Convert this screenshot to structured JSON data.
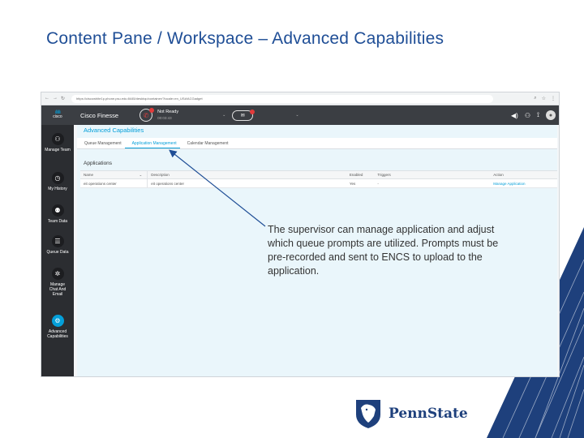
{
  "slide": {
    "title": "Content Pane / Workspace – Advanced Capabilities",
    "callout": "The supervisor can manage application and adjust which queue prompts are utilized. Prompts must be pre-recorded and sent to ENCS to upload to the application.",
    "logo_text": "PennState"
  },
  "browser": {
    "url": "https://ciscowhite1p.phone.psu.edu:8445/desktop/container/?locale=en_US#/ACGadget"
  },
  "finesse": {
    "brand": "cisco",
    "app_title": "Cisco Finesse",
    "status": "Not Ready",
    "timer": "00:03:43"
  },
  "sidebar": {
    "items": [
      {
        "label": "Manage Team",
        "icon": "manage-team-icon"
      },
      {
        "label": "My History",
        "icon": "history-icon"
      },
      {
        "label": "Team Data",
        "icon": "team-data-icon"
      },
      {
        "label": "Queue Data",
        "icon": "queue-data-icon"
      },
      {
        "label": "Manage Chat And Email",
        "icon": "gear-icon"
      },
      {
        "label": "Advanced Capabilities",
        "icon": "advanced-icon"
      }
    ]
  },
  "content": {
    "title": "Advanced Capabilities",
    "tabs": [
      {
        "label": "Queue Management"
      },
      {
        "label": "Application Management"
      },
      {
        "label": "Calendar Management"
      }
    ],
    "applications_title": "Applications",
    "table": {
      "headers": [
        "Name",
        "Description",
        "Enabled",
        "Triggers",
        "Action"
      ],
      "rows": [
        [
          "eit operations center",
          "eit operations center",
          "Yes",
          "-",
          "Manage Application"
        ]
      ]
    }
  },
  "colors": {
    "title_blue": "#1f4e96",
    "finesse_accent": "#049fd9",
    "header_dark": "#3b3e43",
    "penn_state_navy": "#1e407c"
  }
}
